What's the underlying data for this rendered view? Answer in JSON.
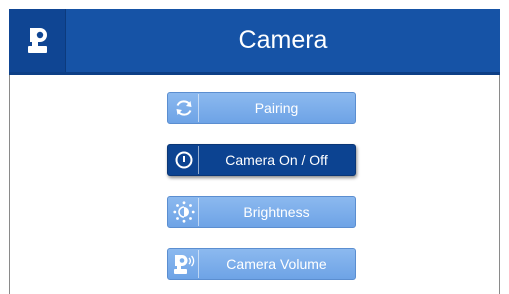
{
  "header": {
    "title": "Camera",
    "icon": "camera-icon",
    "color": "#1653a6"
  },
  "menu": {
    "items": [
      {
        "label": "Pairing",
        "icon": "refresh-icon",
        "selected": false
      },
      {
        "label": "Camera On / Off",
        "icon": "power-icon",
        "selected": true
      },
      {
        "label": "Brightness",
        "icon": "brightness-icon",
        "selected": false
      },
      {
        "label": "Camera Volume",
        "icon": "camera-volume-icon",
        "selected": false
      }
    ]
  },
  "colors": {
    "button_light": "#7aaeea",
    "button_selected": "#0c4391"
  }
}
